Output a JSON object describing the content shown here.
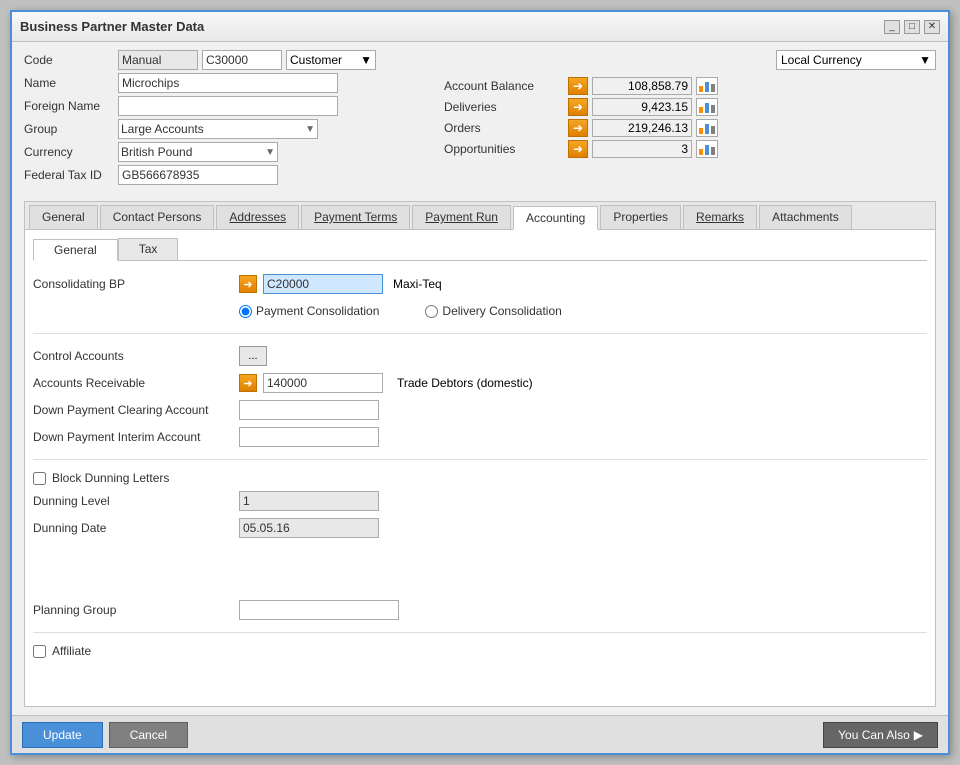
{
  "window": {
    "title": "Business Partner Master Data"
  },
  "header": {
    "code_label": "Code",
    "code_value": "Manual",
    "code_id": "C30000",
    "bp_type": "Customer",
    "name_label": "Name",
    "name_value": "Microchips",
    "foreign_name_label": "Foreign Name",
    "foreign_name_value": "",
    "group_label": "Group",
    "group_value": "Large Accounts",
    "currency_label": "Currency",
    "currency_value": "British Pound",
    "federal_tax_label": "Federal Tax ID",
    "federal_tax_value": "GB566678935"
  },
  "right_panel": {
    "currency_select": "Local Currency",
    "account_balance_label": "Account Balance",
    "account_balance_value": "108,858.79",
    "deliveries_label": "Deliveries",
    "deliveries_value": "9,423.15",
    "orders_label": "Orders",
    "orders_value": "219,246.13",
    "opportunities_label": "Opportunities",
    "opportunities_value": "3"
  },
  "tabs": {
    "items": [
      {
        "label": "General",
        "active": false
      },
      {
        "label": "Contact Persons",
        "active": false
      },
      {
        "label": "Addresses",
        "active": false,
        "underline": true
      },
      {
        "label": "Payment Terms",
        "active": false,
        "underline": true
      },
      {
        "label": "Payment Run",
        "active": false,
        "underline": true
      },
      {
        "label": "Accounting",
        "active": true
      },
      {
        "label": "Properties",
        "active": false
      },
      {
        "label": "Remarks",
        "active": false,
        "underline": true
      },
      {
        "label": "Attachments",
        "active": false
      }
    ]
  },
  "inner_tabs": {
    "items": [
      {
        "label": "General",
        "active": true
      },
      {
        "label": "Tax",
        "active": false
      }
    ]
  },
  "accounting_form": {
    "consolidating_bp_label": "Consolidating BP",
    "consolidating_bp_value": "C20000",
    "consolidating_bp_name": "Maxi-Teq",
    "payment_consolidation_label": "Payment Consolidation",
    "delivery_consolidation_label": "Delivery Consolidation",
    "control_accounts_label": "Control Accounts",
    "accounts_receivable_label": "Accounts Receivable",
    "accounts_receivable_value": "140000",
    "accounts_receivable_name": "Trade Debtors (domestic)",
    "down_payment_clearing_label": "Down Payment Clearing Account",
    "down_payment_clearing_value": "",
    "down_payment_interim_label": "Down Payment Interim Account",
    "down_payment_interim_value": "",
    "block_dunning_label": "Block Dunning Letters",
    "dunning_level_label": "Dunning Level",
    "dunning_level_value": "1",
    "dunning_date_label": "Dunning Date",
    "dunning_date_value": "05.05.16",
    "planning_group_label": "Planning Group",
    "planning_group_value": "",
    "affiliate_label": "Affiliate"
  },
  "bottom": {
    "update_label": "Update",
    "cancel_label": "Cancel",
    "you_can_also_label": "You Can Also"
  }
}
